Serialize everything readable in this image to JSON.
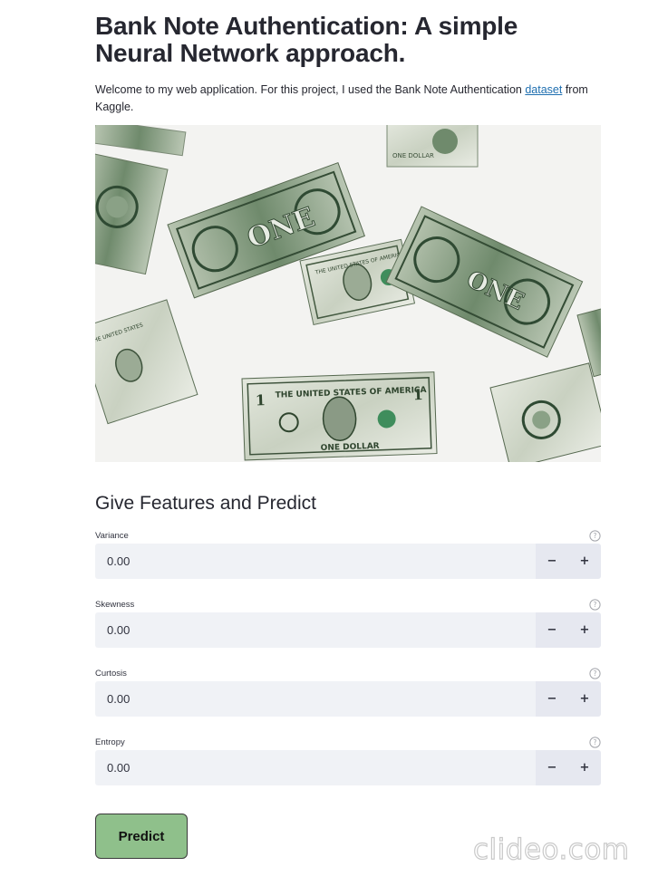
{
  "header": {
    "title": "Bank Note Authentication: A simple Neural Network approach.",
    "intro_before": "Welcome to my web application. For this project, I used the Bank Note Authentication ",
    "intro_link": "dataset",
    "intro_after": " from Kaggle."
  },
  "hero_image": {
    "alt": "bank-notes-photo"
  },
  "form": {
    "section_title": "Give Features and Predict",
    "fields": [
      {
        "label": "Variance",
        "value": "0.00",
        "minus": "−",
        "plus": "+"
      },
      {
        "label": "Skewness",
        "value": "0.00",
        "minus": "−",
        "plus": "+"
      },
      {
        "label": "Curtosis",
        "value": "0.00",
        "minus": "−",
        "plus": "+"
      },
      {
        "label": "Entropy",
        "value": "0.00",
        "minus": "−",
        "plus": "+"
      }
    ],
    "predict_label": "Predict"
  },
  "watermark": {
    "text": "clideo.com"
  },
  "colors": {
    "predict_bg": "#8fc08b",
    "input_bg": "#f0f2f6",
    "link": "#1f6fb0",
    "text": "#262730"
  }
}
